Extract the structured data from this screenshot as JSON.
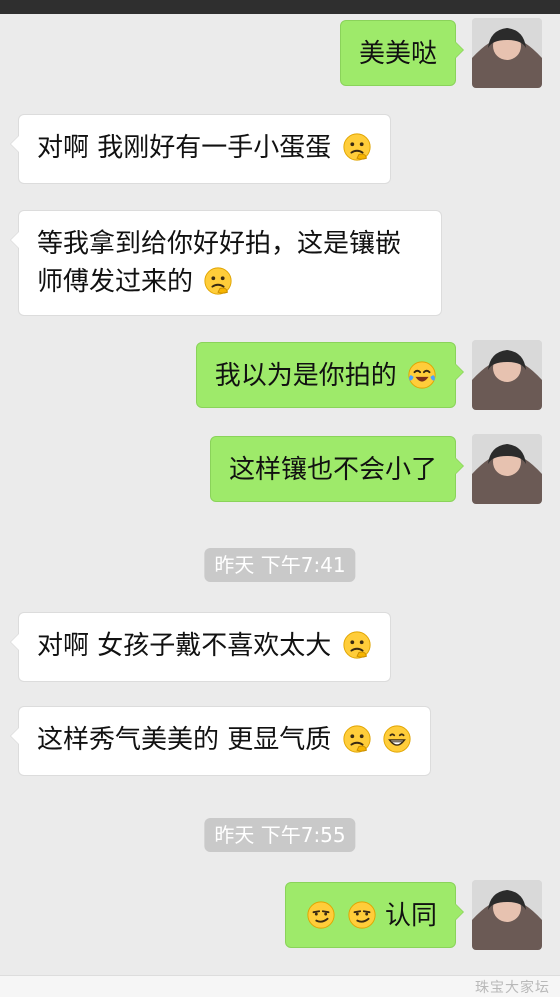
{
  "messages": {
    "m1": {
      "text": "美美哒"
    },
    "m2": {
      "text": "对啊 我刚好有一手小蛋蛋",
      "emoji": [
        "thinking-face-icon"
      ]
    },
    "m3": {
      "text": "等我拿到给你好好拍，这是镶嵌师傅发过来的",
      "emoji": [
        "thinking-face-icon"
      ]
    },
    "m4": {
      "text": "我以为是你拍的",
      "emoji": [
        "laughing-tears-face-icon"
      ]
    },
    "m5": {
      "text": "这样镶也不会小了"
    },
    "t1": {
      "text": "昨天 下午7:41"
    },
    "m6": {
      "text": "对啊 女孩子戴不喜欢太大",
      "emoji": [
        "thinking-face-icon"
      ]
    },
    "m7": {
      "text": "这样秀气美美的 更显气质",
      "emoji": [
        "thinking-face-icon",
        "grinning-face-icon"
      ]
    },
    "t2": {
      "text": "昨天 下午7:55"
    },
    "m8": {
      "text": "认同",
      "emoji": [
        "smirk-face-icon",
        "smirk-face-icon"
      ]
    }
  },
  "colors": {
    "background": "#ebebeb",
    "bubble_self": "#9eea6a",
    "bubble_other": "#ffffff",
    "timestamp_bg": "#c9c9c9"
  },
  "watermark": {
    "text": "珠宝大家坛"
  }
}
